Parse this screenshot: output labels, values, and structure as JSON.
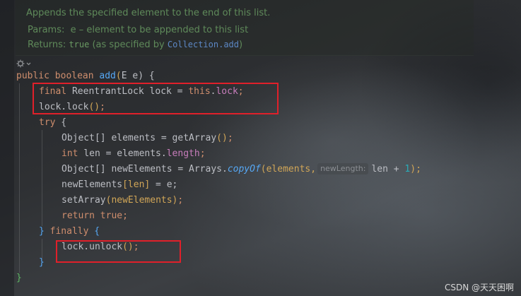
{
  "javadoc": {
    "description": "Appends the specified element to the end of this list.",
    "params_label": "Params:",
    "params_value": "e – element to be appended to this list",
    "returns_label": "Returns:",
    "returns_code": "true",
    "returns_text": " (as specified by ",
    "returns_link": "Collection.add",
    "returns_close": ")"
  },
  "code": {
    "l1_kw": "public boolean ",
    "l1_fn": "add",
    "l1_open": "(",
    "l1_type": "E",
    "l1_rest": " e) {",
    "l2_kw": "final ",
    "l2_type": "ReentrantLock lock = ",
    "l2_this": "this",
    "l2_dot": ".",
    "l2_field": "lock",
    "l2_semi": ";",
    "l3_a": "lock.lock",
    "l3_b": "()",
    "l3_c": ";",
    "l4_kw": "try",
    "l4_b": " {",
    "l5_a": "Object[] elements = ",
    "l5_fn": "getArray",
    "l5_b": "()",
    "l5_c": ";",
    "l6_kw": "int ",
    "l6_a": "len = elements.",
    "l6_field": "length",
    "l6_c": ";",
    "l7_a": "Object[] newElements = Arrays.",
    "l7_fn": "copyOf",
    "l7_b": "(elements,",
    "l7_hint": "newLength:",
    "l7_c": "len + ",
    "l7_num": "1",
    "l7_d": ");",
    "l8_a": "newElements",
    "l8_b": "[len]",
    "l8_c": " = e;",
    "l9_a": "setArray",
    "l9_b": "(newElements)",
    "l9_c": ";",
    "l10_kw": "return true",
    "l10_c": ";",
    "l11_a": "} ",
    "l11_kw": "finally",
    "l11_b": " {",
    "l12_a": "lock.unlock",
    "l12_b": "()",
    "l12_c": ";",
    "l13": "}",
    "l14": "}"
  },
  "watermark": "CSDN @天天困啊",
  "colors": {
    "keyword": "#cf8e6d",
    "function": "#56a8f5",
    "field": "#c77dbb",
    "number": "#2aacb8",
    "doc_text": "#5f8a5a",
    "highlight_box": "#e0202a"
  }
}
